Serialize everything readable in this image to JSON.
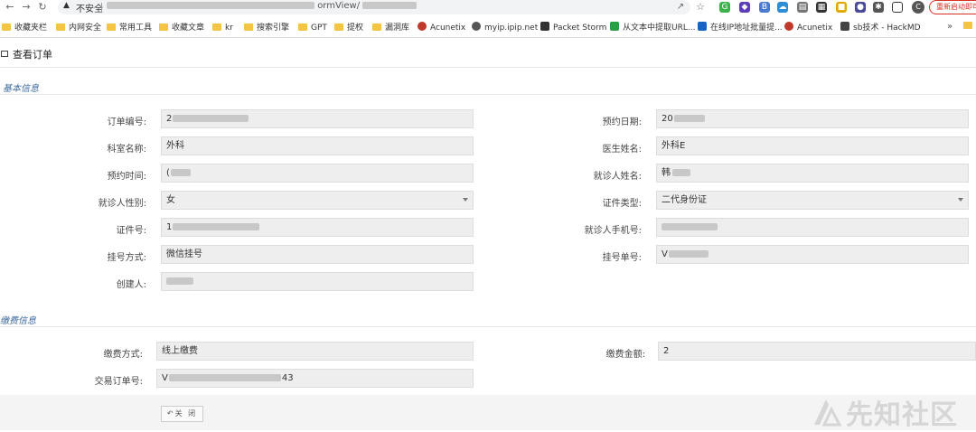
{
  "browser": {
    "security_label": "不安全",
    "url_visible": "ormView/",
    "restart_label": "重新启动即可",
    "avatar_letter": "C"
  },
  "bookmarks": [
    {
      "label": "收藏夹栏",
      "type": "folder"
    },
    {
      "label": "内网安全",
      "type": "folder"
    },
    {
      "label": "常用工具",
      "type": "folder"
    },
    {
      "label": "收藏文章",
      "type": "folder"
    },
    {
      "label": "kr",
      "type": "folder"
    },
    {
      "label": "搜索引擎",
      "type": "folder"
    },
    {
      "label": "GPT",
      "type": "folder"
    },
    {
      "label": "提权",
      "type": "folder"
    },
    {
      "label": "漏洞库",
      "type": "folder"
    },
    {
      "label": "Acunetix",
      "type": "site"
    },
    {
      "label": "myip.ipip.net",
      "type": "site"
    },
    {
      "label": "Packet Storm",
      "type": "site"
    },
    {
      "label": "从文本中提取URL...",
      "type": "site"
    },
    {
      "label": "在线IP地址批量提...",
      "type": "site"
    },
    {
      "label": "Acunetix",
      "type": "site"
    },
    {
      "label": "sb技术 - HackMD",
      "type": "site"
    }
  ],
  "bookmarks_more": "»",
  "page": {
    "title": "查看订单"
  },
  "basic_info": {
    "section_title": "基本信息",
    "order_no_label": "订单编号:",
    "order_no_value": "2",
    "appoint_date_label": "预约日期:",
    "appoint_date_value": "20",
    "dept_label": "科室名称:",
    "dept_value": "外科",
    "doctor_label": "医生姓名:",
    "doctor_value": "外科E",
    "appoint_time_label": "预约时间:",
    "appoint_time_value": "(",
    "patient_name_label": "就诊人姓名:",
    "patient_name_value": "韩",
    "gender_label": "就诊人性别:",
    "gender_value": "女",
    "id_type_label": "证件类型:",
    "id_type_value": "二代身份证",
    "id_no_label": "证件号:",
    "id_no_value": "1",
    "phone_label": "就诊人手机号:",
    "phone_value": "",
    "reg_method_label": "挂号方式:",
    "reg_method_value": "微信挂号",
    "reg_no_label": "挂号单号:",
    "reg_no_value": "V",
    "creator_label": "创建人:",
    "creator_value": ""
  },
  "payment_info": {
    "section_title": "缴费信息",
    "pay_method_label": "缴费方式:",
    "pay_method_value": "线上缴费",
    "amount_label": "缴费金额:",
    "amount_value": "2",
    "trade_no_label": "交易订单号:",
    "trade_no_value_prefix": "V",
    "trade_no_value_suffix": "43"
  },
  "close_button": "关 闭",
  "watermark": "先知社区",
  "colors": {
    "section_title": "#3b6aa0",
    "field_bg": "#eeeeee",
    "restart": "#d93025"
  }
}
